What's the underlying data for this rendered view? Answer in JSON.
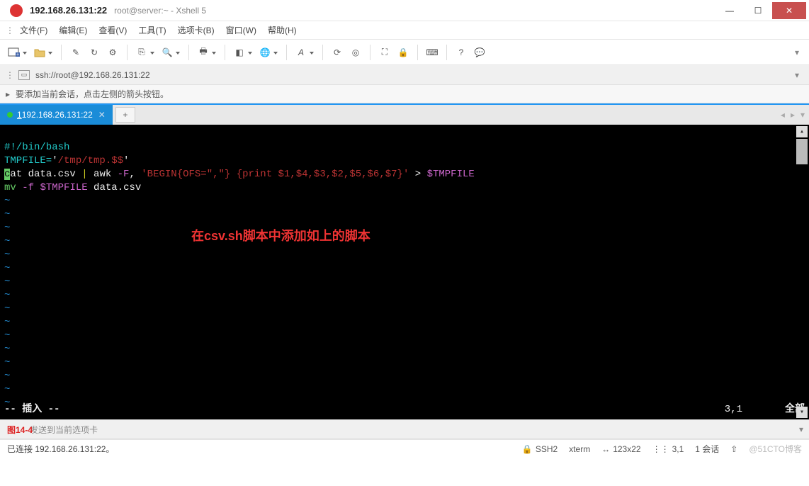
{
  "titlebar": {
    "title_main": "192.168.26.131:22",
    "title_sub": "root@server:~ - Xshell 5"
  },
  "menubar": {
    "file": "文件(F)",
    "edit": "编辑(E)",
    "view": "查看(V)",
    "tools": "工具(T)",
    "tabs": "选项卡(B)",
    "window": "窗口(W)",
    "help": "帮助(H)"
  },
  "addressbar": {
    "url": "ssh://root@192.168.26.131:22"
  },
  "hintbar": {
    "text": "要添加当前会话，点击左侧的箭头按钮。"
  },
  "tabs": {
    "active_prefix": "1",
    "active_label": " 192.168.26.131:22"
  },
  "terminal": {
    "shebang": "#!/bin/bash",
    "l2_a": "TMPFILE=",
    "l2_b": "'",
    "l2_c": "/tmp/tmp.$$",
    "l2_d": "'",
    "l3_cursor": "c",
    "l3_a": "at data.csv ",
    "l3_b": "|",
    "l3_c": " awk ",
    "l3_d": "-F",
    "l3_e": ", ",
    "l3_f": "'BEGIN{OFS=\",\"} {print $1,$4,$3,$2,$5,$6,$7}'",
    "l3_g": " > ",
    "l3_h": "$TMPFILE",
    "l4_a": "mv ",
    "l4_b": "-f ",
    "l4_c": "$TMPFILE",
    "l4_d": " data.csv",
    "tilde": "~",
    "annotation": "在csv.sh脚本中添加如上的脚本",
    "mode": "-- 插入 --",
    "cursor_pos": "3,1",
    "scroll": "全部"
  },
  "sendbar": {
    "figure_label": "图14-4",
    "placeholder": "发送到当前选项卡"
  },
  "statusbar": {
    "connection": "已连接 192.168.26.131:22。",
    "ssh": "SSH2",
    "term": "xterm",
    "size": "123x22",
    "pos": "3,1",
    "sessions": "1 会话",
    "watermark": "@51CTO博客"
  }
}
